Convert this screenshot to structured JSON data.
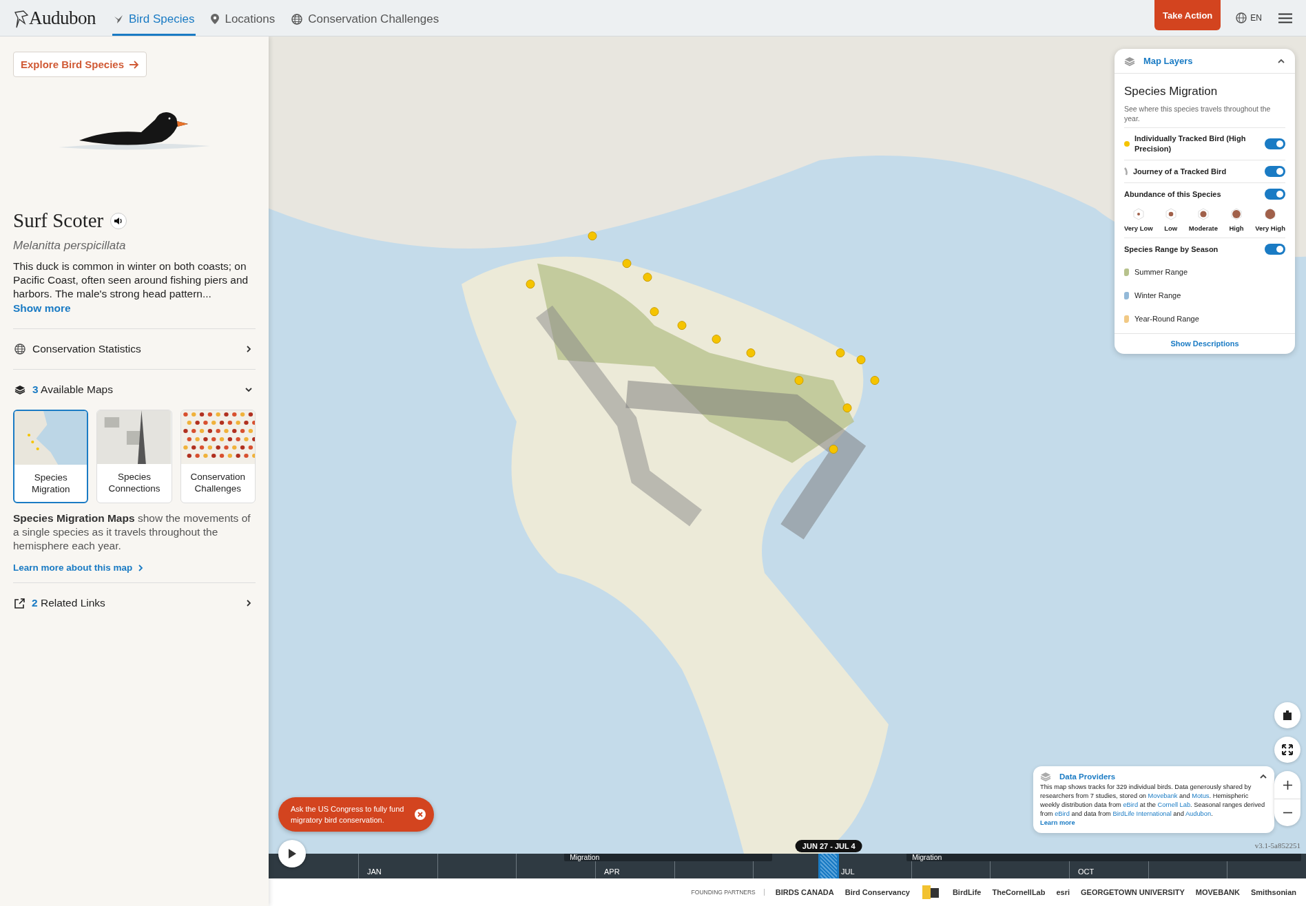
{
  "header": {
    "logo": "Audubon",
    "nav": [
      {
        "label": "Bird Species",
        "selected": true
      },
      {
        "label": "Locations",
        "selected": false
      },
      {
        "label": "Conservation Challenges",
        "selected": false
      }
    ],
    "action_button": "Take Action",
    "language": "EN"
  },
  "sidebar": {
    "explore_button": "Explore Bird Species",
    "bird": {
      "name": "Surf Scoter",
      "scientific_name": "Melanitta perspicillata",
      "description": "This duck is common in winter on both coasts; on Pacific Coast, often seen around fishing piers and harbors. The male's strong head pattern...",
      "show_more": "Show more"
    },
    "conservation_statistics": "Conservation Statistics",
    "available_maps": {
      "count": "3",
      "label": "Available Maps",
      "expanded": true,
      "maps": [
        {
          "label": "Species Migration",
          "selected": true,
          "kind": "migration"
        },
        {
          "label": "Species Connections",
          "selected": false,
          "kind": "connections"
        },
        {
          "label": "Conservation Challenges",
          "selected": false,
          "kind": "challenges"
        }
      ],
      "description": "**Species Migration Maps** show the movements of a single species as it travels throughout the hemisphere each year.",
      "learn_more": "Learn more about this map"
    },
    "related_links": {
      "count": "2",
      "label": "Related Links"
    }
  },
  "map_layers": {
    "title": "Map Layers",
    "expanded": true,
    "heading": "Species Migration",
    "subtitle": "See where this species travels throughout the year.",
    "layers": [
      {
        "kind": "dot",
        "label": "Individually Tracked Bird (High Precision)",
        "on": true
      },
      {
        "kind": "track",
        "label": "Journey of a Tracked Bird",
        "on": true
      },
      {
        "kind": "abundance",
        "label": "Abundance of this Species",
        "on": true,
        "levels": [
          "Very Low",
          "Low",
          "Moderate",
          "High",
          "Very High"
        ]
      },
      {
        "kind": "range",
        "label": "Species Range by Season",
        "on": true,
        "ranges": [
          {
            "label": "Summer Range",
            "color": "#b7c28c"
          },
          {
            "label": "Winter Range",
            "color": "#93b9d8"
          },
          {
            "label": "Year-Round Range",
            "color": "#f1c985"
          }
        ]
      }
    ],
    "show_descriptions": "Show Descriptions"
  },
  "data_providers": {
    "title": "Data Providers",
    "expanded": true,
    "segments": [
      {
        "text": "This map shows tracks for 329 individual birds. Data generously shared by researchers from 7 studies, stored on ",
        "kind": "plain"
      },
      {
        "text": "Movebank",
        "kind": "link"
      },
      {
        "text": " and ",
        "kind": "plain"
      },
      {
        "text": "Motus",
        "kind": "link"
      },
      {
        "text": ". Hemispheric weekly distribution data from ",
        "kind": "plain"
      },
      {
        "text": "eBird",
        "kind": "link"
      },
      {
        "text": " at the ",
        "kind": "plain"
      },
      {
        "text": "Cornell Lab",
        "kind": "link"
      },
      {
        "text": ". Seasonal ranges derived from ",
        "kind": "plain"
      },
      {
        "text": "eBird",
        "kind": "link"
      },
      {
        "text": " and data from ",
        "kind": "plain"
      },
      {
        "text": "BirdLife International",
        "kind": "link"
      },
      {
        "text": " and ",
        "kind": "plain"
      },
      {
        "text": "Audubon",
        "kind": "link"
      },
      {
        "text": ".",
        "kind": "plain"
      }
    ],
    "learn_more": "Learn more"
  },
  "banner": {
    "text": "Ask the US Congress to fully fund migratory bird conservation."
  },
  "version": "v3.1-5a852251",
  "timeline": {
    "date_range": "JUN 27 - JUL 4",
    "level": 0.54,
    "month_labels": [
      "JAN",
      "APR",
      "JUL",
      "OCT"
    ],
    "migration_periods": [
      "Migration",
      "Migration"
    ]
  },
  "partners": {
    "label": "FOUNDING PARTNERS",
    "logos": [
      {
        "kind": "text",
        "text": "BIRDS CANADA"
      },
      {
        "kind": "text",
        "text": "Bird Conservancy"
      },
      {
        "kind": "mark"
      },
      {
        "kind": "text",
        "text": "BirdLife"
      },
      {
        "kind": "text",
        "text": "TheCornellLab"
      },
      {
        "kind": "text",
        "text": "esri"
      },
      {
        "kind": "text",
        "text": "GEORGETOWN UNIVERSITY"
      },
      {
        "kind": "text",
        "text": "MOVEBANK"
      },
      {
        "kind": "text",
        "text": "Smithsonian"
      }
    ]
  }
}
